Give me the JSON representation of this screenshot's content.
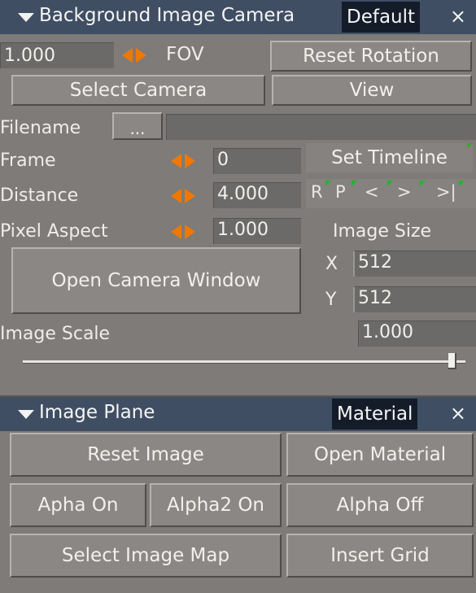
{
  "panel1": {
    "title": "Background Image Camera",
    "preset": "Default",
    "close": "×",
    "fov_value": "1.000",
    "fov_label": "FOV",
    "reset_rotation": "Reset Rotation",
    "select_camera": "Select Camera",
    "view": "View",
    "filename_label": "Filename",
    "browse": "...",
    "frame_label": "Frame",
    "frame_value": "0",
    "set_timeline": "Set Timeline",
    "distance_label": "Distance",
    "distance_value": "4.000",
    "nav": {
      "r": "R",
      "p": "P",
      "prev": "<",
      "next": ">",
      "last": ">|"
    },
    "pixel_aspect_label": "Pixel  Aspect",
    "pixel_aspect_value": "1.000",
    "image_size_label": "Image Size",
    "open_camera_window": "Open Camera Window",
    "x_label": "X",
    "x_value": "512",
    "y_label": "Y",
    "y_value": "512",
    "image_scale_label": "Image Scale",
    "image_scale_value": "1.000",
    "image_scale_slider": 0.98
  },
  "panel2": {
    "title": "Image Plane",
    "preset": "Material",
    "close": "×",
    "reset_image": "Reset Image",
    "open_material": "Open Material",
    "alpha_on": "Apha On",
    "alpha2_on": "Alpha2 On",
    "alpha_off": "Alpha Off",
    "select_image_map": "Select Image Map",
    "insert_grid": "Insert Grid"
  },
  "colors": {
    "titlebar": "#3f4e63",
    "panel_bg": "#7e7b78",
    "spinner_arrow": "#f07800",
    "timeline_marker": "#23b52a"
  }
}
